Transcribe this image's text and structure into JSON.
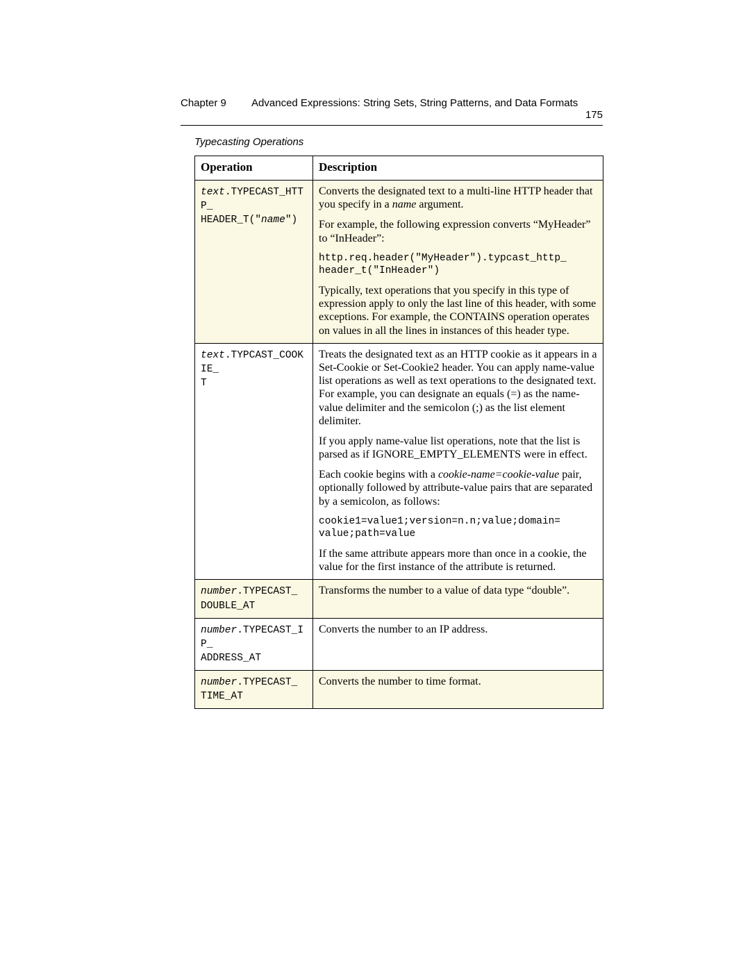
{
  "header": {
    "chapter": "Chapter 9",
    "title": "Advanced Expressions: String Sets, String Patterns, and Data Formats",
    "page": "175"
  },
  "caption": "Typecasting Operations",
  "table": {
    "head": {
      "op": "Operation",
      "desc": "Description"
    },
    "rows": [
      {
        "shade": true,
        "op_prefix": "text",
        "op_mid": ".TYPECAST_HTTP_",
        "op_line2a": "HEADER_T(\"",
        "op_name": "name",
        "op_line2b": "\")",
        "d1a": "Converts the designated text to a multi-line HTTP header that you specify in a ",
        "d1_name": "name",
        "d1b": " argument.",
        "d2": "For example, the following expression converts “MyHeader” to “InHeader”:",
        "d3_code": "http.req.header(\"MyHeader\").typcast_http_\nheader_t(\"InHeader\")",
        "d4": "Typically, text operations that you specify in this type of expression apply to only the last line of this header, with some exceptions. For example, the CONTAINS operation operates on values in all the lines in instances of this header type."
      },
      {
        "shade": false,
        "op_prefix": "text",
        "op_rest": ".TYPCAST_COOKIE_\nT",
        "d1": "Treats the designated text as an HTTP cookie as it appears in a Set-Cookie or Set-Cookie2 header. You can apply name-value list operations as well as text operations to the designated text. For example, you can designate an equals (=) as the name-value delimiter and the semicolon (;) as the list element delimiter.",
        "d2": "If you apply name-value list operations, note that the list is parsed as if IGNORE_EMPTY_ELEMENTS were in effect.",
        "d3a": "Each cookie begins with a ",
        "d3_ital": "cookie-name=cookie-value",
        "d3b": " pair, optionally followed by attribute-value pairs that are separated by a semicolon, as follows:",
        "d4_code": "cookie1=value1;version=n.n;value;domain=\nvalue;path=value",
        "d5": "If the same attribute appears more than once in a cookie, the value for the first instance of the attribute is returned."
      },
      {
        "shade": true,
        "op_prefix": "number",
        "op_rest": ".TYPECAST_\nDOUBLE_AT",
        "d1": "Transforms the number to a value of data type “double”."
      },
      {
        "shade": false,
        "op_prefix": "number",
        "op_rest": ".TYPECAST_IP_\nADDRESS_AT",
        "d1": "Converts the number to an IP address."
      },
      {
        "shade": true,
        "op_prefix": "number",
        "op_rest": ".TYPECAST_\nTIME_AT",
        "d1": "Converts the number to time format."
      }
    ]
  }
}
